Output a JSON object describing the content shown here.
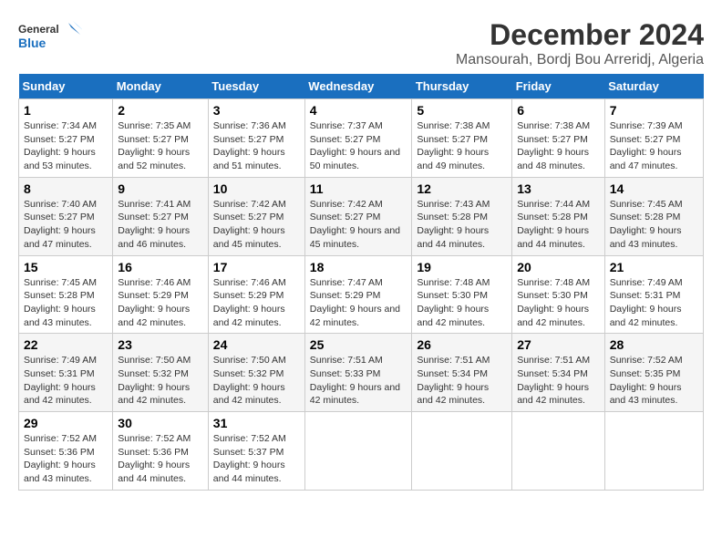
{
  "header": {
    "logo_line1": "General",
    "logo_line2": "Blue",
    "title": "December 2024",
    "subtitle": "Mansourah, Bordj Bou Arreridj, Algeria"
  },
  "columns": [
    "Sunday",
    "Monday",
    "Tuesday",
    "Wednesday",
    "Thursday",
    "Friday",
    "Saturday"
  ],
  "weeks": [
    [
      {
        "day": "1",
        "sunrise": "7:34 AM",
        "sunset": "5:27 PM",
        "daylight": "9 hours and 53 minutes."
      },
      {
        "day": "2",
        "sunrise": "7:35 AM",
        "sunset": "5:27 PM",
        "daylight": "9 hours and 52 minutes."
      },
      {
        "day": "3",
        "sunrise": "7:36 AM",
        "sunset": "5:27 PM",
        "daylight": "9 hours and 51 minutes."
      },
      {
        "day": "4",
        "sunrise": "7:37 AM",
        "sunset": "5:27 PM",
        "daylight": "9 hours and 50 minutes."
      },
      {
        "day": "5",
        "sunrise": "7:38 AM",
        "sunset": "5:27 PM",
        "daylight": "9 hours and 49 minutes."
      },
      {
        "day": "6",
        "sunrise": "7:38 AM",
        "sunset": "5:27 PM",
        "daylight": "9 hours and 48 minutes."
      },
      {
        "day": "7",
        "sunrise": "7:39 AM",
        "sunset": "5:27 PM",
        "daylight": "9 hours and 47 minutes."
      }
    ],
    [
      {
        "day": "8",
        "sunrise": "7:40 AM",
        "sunset": "5:27 PM",
        "daylight": "9 hours and 47 minutes."
      },
      {
        "day": "9",
        "sunrise": "7:41 AM",
        "sunset": "5:27 PM",
        "daylight": "9 hours and 46 minutes."
      },
      {
        "day": "10",
        "sunrise": "7:42 AM",
        "sunset": "5:27 PM",
        "daylight": "9 hours and 45 minutes."
      },
      {
        "day": "11",
        "sunrise": "7:42 AM",
        "sunset": "5:27 PM",
        "daylight": "9 hours and 45 minutes."
      },
      {
        "day": "12",
        "sunrise": "7:43 AM",
        "sunset": "5:28 PM",
        "daylight": "9 hours and 44 minutes."
      },
      {
        "day": "13",
        "sunrise": "7:44 AM",
        "sunset": "5:28 PM",
        "daylight": "9 hours and 44 minutes."
      },
      {
        "day": "14",
        "sunrise": "7:45 AM",
        "sunset": "5:28 PM",
        "daylight": "9 hours and 43 minutes."
      }
    ],
    [
      {
        "day": "15",
        "sunrise": "7:45 AM",
        "sunset": "5:28 PM",
        "daylight": "9 hours and 43 minutes."
      },
      {
        "day": "16",
        "sunrise": "7:46 AM",
        "sunset": "5:29 PM",
        "daylight": "9 hours and 42 minutes."
      },
      {
        "day": "17",
        "sunrise": "7:46 AM",
        "sunset": "5:29 PM",
        "daylight": "9 hours and 42 minutes."
      },
      {
        "day": "18",
        "sunrise": "7:47 AM",
        "sunset": "5:29 PM",
        "daylight": "9 hours and 42 minutes."
      },
      {
        "day": "19",
        "sunrise": "7:48 AM",
        "sunset": "5:30 PM",
        "daylight": "9 hours and 42 minutes."
      },
      {
        "day": "20",
        "sunrise": "7:48 AM",
        "sunset": "5:30 PM",
        "daylight": "9 hours and 42 minutes."
      },
      {
        "day": "21",
        "sunrise": "7:49 AM",
        "sunset": "5:31 PM",
        "daylight": "9 hours and 42 minutes."
      }
    ],
    [
      {
        "day": "22",
        "sunrise": "7:49 AM",
        "sunset": "5:31 PM",
        "daylight": "9 hours and 42 minutes."
      },
      {
        "day": "23",
        "sunrise": "7:50 AM",
        "sunset": "5:32 PM",
        "daylight": "9 hours and 42 minutes."
      },
      {
        "day": "24",
        "sunrise": "7:50 AM",
        "sunset": "5:32 PM",
        "daylight": "9 hours and 42 minutes."
      },
      {
        "day": "25",
        "sunrise": "7:51 AM",
        "sunset": "5:33 PM",
        "daylight": "9 hours and 42 minutes."
      },
      {
        "day": "26",
        "sunrise": "7:51 AM",
        "sunset": "5:34 PM",
        "daylight": "9 hours and 42 minutes."
      },
      {
        "day": "27",
        "sunrise": "7:51 AM",
        "sunset": "5:34 PM",
        "daylight": "9 hours and 42 minutes."
      },
      {
        "day": "28",
        "sunrise": "7:52 AM",
        "sunset": "5:35 PM",
        "daylight": "9 hours and 43 minutes."
      }
    ],
    [
      {
        "day": "29",
        "sunrise": "7:52 AM",
        "sunset": "5:36 PM",
        "daylight": "9 hours and 43 minutes."
      },
      {
        "day": "30",
        "sunrise": "7:52 AM",
        "sunset": "5:36 PM",
        "daylight": "9 hours and 44 minutes."
      },
      {
        "day": "31",
        "sunrise": "7:52 AM",
        "sunset": "5:37 PM",
        "daylight": "9 hours and 44 minutes."
      },
      null,
      null,
      null,
      null
    ]
  ]
}
